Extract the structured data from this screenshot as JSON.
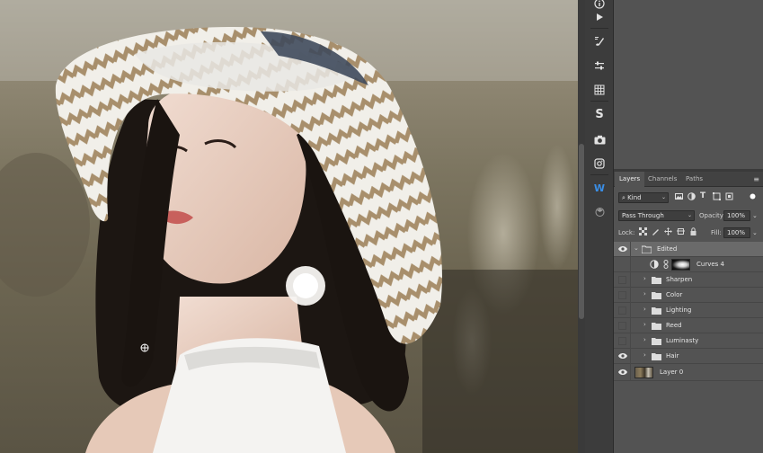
{
  "tools": [
    {
      "id": "info",
      "icon": "info-icon"
    },
    {
      "id": "play",
      "icon": "play-icon"
    },
    {
      "id": "brush",
      "icon": "brush-settings-icon"
    },
    {
      "id": "adjust",
      "icon": "adjustments-icon"
    },
    {
      "id": "grid",
      "icon": "grid-icon"
    },
    {
      "id": "styles",
      "icon": "styles-icon",
      "glyph": "S"
    },
    {
      "id": "camera",
      "icon": "camera-icon"
    },
    {
      "id": "instagram",
      "icon": "instagram-icon"
    },
    {
      "id": "wextension",
      "icon": "w-extension-icon",
      "glyph": "W"
    },
    {
      "id": "learn",
      "icon": "learn-icon"
    }
  ],
  "layers_panel": {
    "tabs": [
      "Layers",
      "Channels",
      "Paths"
    ],
    "active_tab": "Layers",
    "filter": {
      "kind_label": "Kind"
    },
    "blend_mode": "Pass Through",
    "opacity_label": "Opacity:",
    "opacity_value": "100%",
    "lock_label": "Lock:",
    "fill_label": "Fill:",
    "fill_value": "100%",
    "layers": [
      {
        "name": "Edited",
        "type": "group",
        "expanded": true,
        "visible": true,
        "selected": true,
        "indent": 0
      },
      {
        "name": "Curves 4",
        "type": "adjustment",
        "visible": false,
        "indent": 1
      },
      {
        "name": "Sharpen",
        "type": "group",
        "expanded": false,
        "visible": false,
        "indent": 1
      },
      {
        "name": "Color",
        "type": "group",
        "expanded": false,
        "visible": false,
        "indent": 1
      },
      {
        "name": "Lighting",
        "type": "group",
        "expanded": false,
        "visible": false,
        "indent": 1
      },
      {
        "name": "Reed",
        "type": "group",
        "expanded": false,
        "visible": false,
        "indent": 1
      },
      {
        "name": "Luminasty",
        "type": "group",
        "expanded": false,
        "visible": false,
        "indent": 1
      },
      {
        "name": "Hair",
        "type": "group",
        "expanded": false,
        "visible": true,
        "indent": 1
      },
      {
        "name": "Layer 0",
        "type": "pixel",
        "visible": true,
        "indent": 0
      }
    ]
  },
  "colors": {
    "panel_bg": "#535353",
    "panel_dark": "#3c3c3c",
    "selected_row": "#6a6a6a",
    "accent_blue": "#3a8ee6"
  }
}
